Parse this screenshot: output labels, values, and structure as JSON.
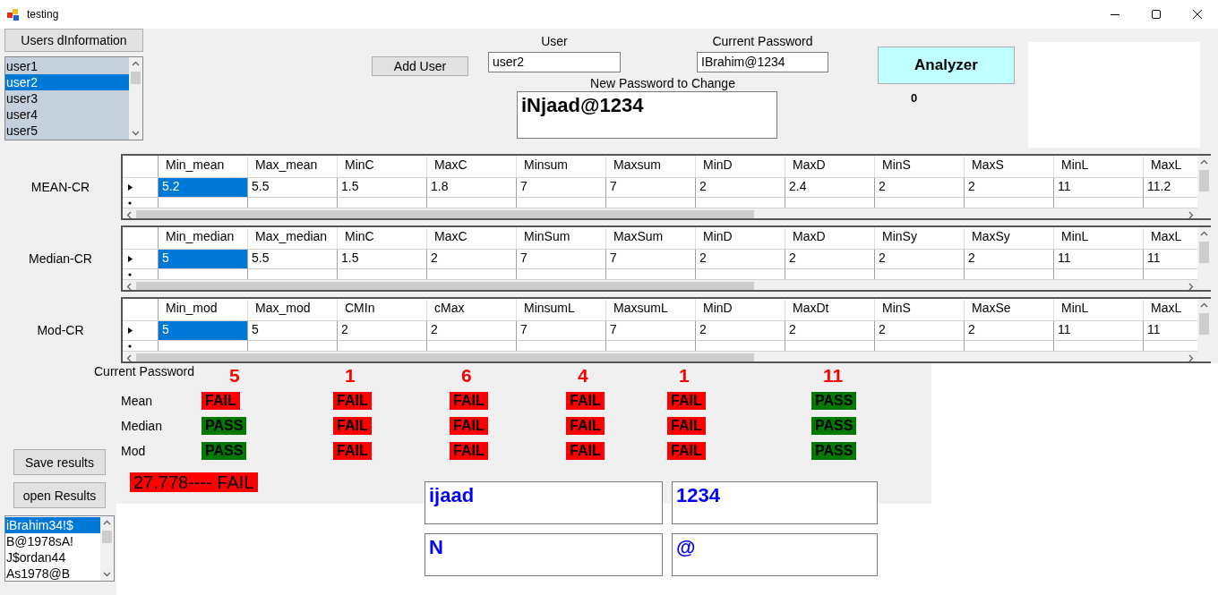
{
  "window": {
    "title": "testing"
  },
  "users_button": "Users dInformation",
  "users_list": [
    {
      "label": "user1",
      "selected": false
    },
    {
      "label": "user2",
      "selected": true
    },
    {
      "label": "user3",
      "selected": false
    },
    {
      "label": "user4",
      "selected": false
    },
    {
      "label": "user5",
      "selected": false
    }
  ],
  "add_user_button": "Add User",
  "user_field": {
    "label": "User",
    "value": "user2"
  },
  "current_password_field": {
    "label": "Current Password",
    "value": "IBrahim@1234"
  },
  "new_password_field": {
    "label": "New Password to Change",
    "value": "iNjaad@1234"
  },
  "analyzer_button": "Analyzer",
  "analyzer_count": "0",
  "grids": [
    {
      "label": "MEAN-CR",
      "columns": [
        "Min_mean",
        "Max_mean",
        "MinC",
        "MaxC",
        "Minsum",
        "Maxsum",
        "MinD",
        "MaxD",
        "MinS",
        "MaxS",
        "MinL",
        "MaxL"
      ],
      "cells": [
        {
          "text": "5.2",
          "selected": true
        },
        {
          "text": "5.5",
          "selected": false
        },
        {
          "text": "1.5",
          "selected": false
        },
        {
          "text": "1.8",
          "selected": false
        },
        {
          "text": "7",
          "selected": false
        },
        {
          "text": "7",
          "selected": false
        },
        {
          "text": "2",
          "selected": false
        },
        {
          "text": "2.4",
          "selected": false
        },
        {
          "text": "2",
          "selected": false
        },
        {
          "text": "2",
          "selected": false
        },
        {
          "text": "11",
          "selected": false
        },
        {
          "text": "11.2",
          "selected": false
        }
      ]
    },
    {
      "label": "Median-CR",
      "columns": [
        "Min_median",
        "Max_median",
        "MinC",
        "MaxC",
        "MinSum",
        "MaxSum",
        "MinD",
        "MaxD",
        "MinSy",
        "MaxSy",
        "MinL",
        "MaxL"
      ],
      "cells": [
        {
          "text": "5",
          "selected": true
        },
        {
          "text": "5.5",
          "selected": false
        },
        {
          "text": "1.5",
          "selected": false
        },
        {
          "text": "2",
          "selected": false
        },
        {
          "text": "7",
          "selected": false
        },
        {
          "text": "7",
          "selected": false
        },
        {
          "text": "2",
          "selected": false
        },
        {
          "text": "2",
          "selected": false
        },
        {
          "text": "2",
          "selected": false
        },
        {
          "text": "2",
          "selected": false
        },
        {
          "text": "11",
          "selected": false
        },
        {
          "text": "11",
          "selected": false
        }
      ]
    },
    {
      "label": "Mod-CR",
      "columns": [
        "Min_mod",
        "Max_mod",
        "CMIn",
        "cMax",
        "MinsumL",
        "MaxsumL",
        "MinD",
        "MaxDt",
        "MinS",
        "MaxSe",
        "MinL",
        "MaxL"
      ],
      "cells": [
        {
          "text": "5",
          "selected": true
        },
        {
          "text": "5",
          "selected": false
        },
        {
          "text": "2",
          "selected": false
        },
        {
          "text": "2",
          "selected": false
        },
        {
          "text": "7",
          "selected": false
        },
        {
          "text": "7",
          "selected": false
        },
        {
          "text": "2",
          "selected": false
        },
        {
          "text": "2",
          "selected": false
        },
        {
          "text": "2",
          "selected": false
        },
        {
          "text": "2",
          "selected": false
        },
        {
          "text": "11",
          "selected": false
        },
        {
          "text": "11",
          "selected": false
        }
      ]
    }
  ],
  "results": {
    "label": "Current Password",
    "counts": [
      "5",
      "1",
      "6",
      "4",
      "1",
      "11"
    ],
    "rows": [
      {
        "label": "Mean",
        "results": [
          {
            "text": "FAIL",
            "pass": false
          },
          {
            "text": "FAIL",
            "pass": false
          },
          {
            "text": "FAIL",
            "pass": false
          },
          {
            "text": "FAIL",
            "pass": false
          },
          {
            "text": "FAIL",
            "pass": false
          },
          {
            "text": "PASS",
            "pass": true
          }
        ]
      },
      {
        "label": "Median",
        "results": [
          {
            "text": "PASS",
            "pass": true
          },
          {
            "text": "FAIL",
            "pass": false
          },
          {
            "text": "FAIL",
            "pass": false
          },
          {
            "text": "FAIL",
            "pass": false
          },
          {
            "text": "FAIL",
            "pass": false
          },
          {
            "text": "PASS",
            "pass": true
          }
        ]
      },
      {
        "label": "Mod",
        "results": [
          {
            "text": "PASS",
            "pass": true
          },
          {
            "text": "FAIL",
            "pass": false
          },
          {
            "text": "FAIL",
            "pass": false
          },
          {
            "text": "FAIL",
            "pass": false
          },
          {
            "text": "FAIL",
            "pass": false
          },
          {
            "text": "PASS",
            "pass": true
          }
        ]
      }
    ],
    "overall": {
      "text": "27.778---- FAIL",
      "pass": false
    }
  },
  "save_button": "Save results",
  "open_button": "open Results",
  "passwords_list": [
    {
      "label": "iBrahim34!$",
      "selected": true
    },
    {
      "label": "B@1978sA!",
      "selected": false
    },
    {
      "label": "J$ordan44",
      "selected": false
    },
    {
      "label": "As1978@B",
      "selected": false
    }
  ],
  "password_parts": [
    "ijaad",
    "1234",
    "N",
    "@"
  ]
}
